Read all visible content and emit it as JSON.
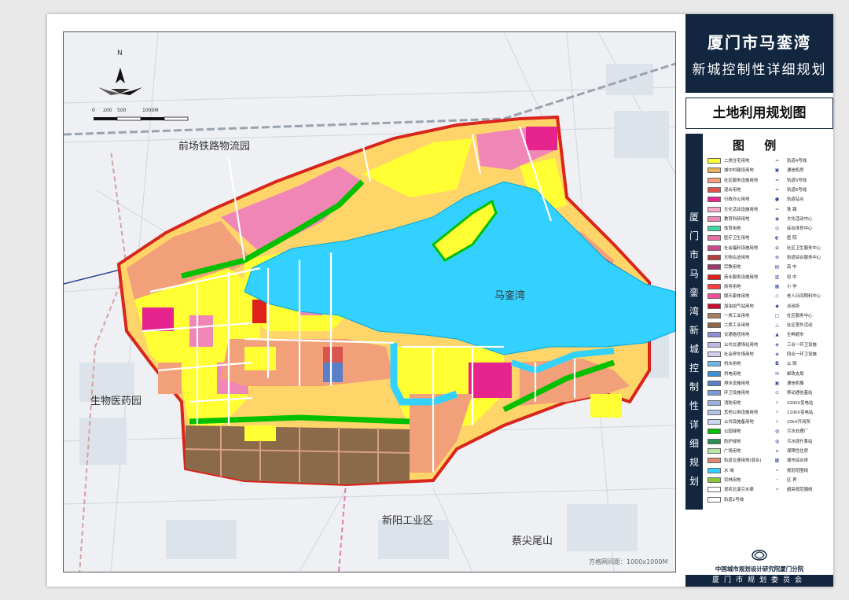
{
  "title": {
    "line1": "厦门市马銮湾",
    "line2": "新城控制性详细规划"
  },
  "subtitle": "土地利用规划图",
  "legend": {
    "heading": "图  例",
    "side_text": "厦门市马銮湾新城控制性详细规划",
    "left_items": [
      {
        "label": "二类住宅用地",
        "color": "#ffff33"
      },
      {
        "label": "城中村建设用地",
        "color": "#e8b25c"
      },
      {
        "label": "社区服务设施用地",
        "color": "#f2a07a"
      },
      {
        "label": "混合用地",
        "color": "#d9534f"
      },
      {
        "label": "行政办公用地",
        "color": "#e7238d"
      },
      {
        "label": "文化活动设施用地",
        "color": "#f7a8c9"
      },
      {
        "label": "教育科研用地",
        "color": "#f086b5"
      },
      {
        "label": "体育用地",
        "color": "#3fd4a2"
      },
      {
        "label": "医疗卫生用地",
        "color": "#e66fa3"
      },
      {
        "label": "社会福利设施用地",
        "color": "#c94b8c"
      },
      {
        "label": "文物古迹用地",
        "color": "#b0413e"
      },
      {
        "label": "宗教用地",
        "color": "#9b3b6b"
      },
      {
        "label": "商业服务设施用地",
        "color": "#e0201b"
      },
      {
        "label": "商务用地",
        "color": "#ff3b3b"
      },
      {
        "label": "娱乐康体用地",
        "color": "#f0509a"
      },
      {
        "label": "加油加气站用地",
        "color": "#c8102e"
      },
      {
        "label": "一类工业用地",
        "color": "#a58060"
      },
      {
        "label": "二类工业用地",
        "color": "#8b6a4a"
      },
      {
        "label": "交通枢纽用地",
        "color": "#8f8fd6"
      },
      {
        "label": "公共交通场站用地",
        "color": "#b9b9e3"
      },
      {
        "label": "社会停车场用地",
        "color": "#d0d0ee"
      },
      {
        "label": "供水用地",
        "color": "#6fb5e8"
      },
      {
        "label": "供电用地",
        "color": "#3f8fd1"
      },
      {
        "label": "排水设施用地",
        "color": "#5a7fc9"
      },
      {
        "label": "环卫设施用地",
        "color": "#7a9bd6"
      },
      {
        "label": "消防用地",
        "color": "#9aaee0"
      },
      {
        "label": "其他公用设施用地",
        "color": "#b0c4ea"
      },
      {
        "label": "公共设施备用地",
        "color": "#c8d6f0"
      },
      {
        "label": "公园绿地",
        "color": "#00c000"
      },
      {
        "label": "防护绿地",
        "color": "#2e8b57"
      },
      {
        "label": "广场用地",
        "color": "#b9e6a6"
      },
      {
        "label": "轨道交通用地(混合)",
        "color": "#d98b6b"
      },
      {
        "label": "水  域",
        "color": "#33d1ff"
      },
      {
        "label": "农林用地",
        "color": "#8cc63f"
      },
      {
        "label": "现状北溪引水渠",
        "color": "#ffffff"
      },
      {
        "label": "轨道2号线",
        "color": "#ffffff"
      }
    ],
    "right_items": [
      {
        "label": "轨道4号线",
        "icon": "━"
      },
      {
        "label": "通信机房",
        "icon": "▣"
      },
      {
        "label": "轨道5号线",
        "icon": "━"
      },
      {
        "label": "轨道6号线",
        "icon": "━"
      },
      {
        "label": "轨道站点",
        "icon": "●"
      },
      {
        "label": "铁  路",
        "icon": "═"
      },
      {
        "label": "文化活动中心",
        "icon": "◉"
      },
      {
        "label": "综合体育中心",
        "icon": "◎"
      },
      {
        "label": "医  院",
        "icon": "◐"
      },
      {
        "label": "社区卫生服务中心",
        "icon": "⊕"
      },
      {
        "label": "街道综合服务中心",
        "icon": "⊗"
      },
      {
        "label": "高  中",
        "icon": "▤"
      },
      {
        "label": "初  中",
        "icon": "▥"
      },
      {
        "label": "小  学",
        "icon": "▦"
      },
      {
        "label": "老人日间照料中心",
        "icon": "◇"
      },
      {
        "label": "派出所",
        "icon": "◆"
      },
      {
        "label": "社区服务中心",
        "icon": "□"
      },
      {
        "label": "社区室外活动",
        "icon": "△"
      },
      {
        "label": "生鲜超市",
        "icon": "▲"
      },
      {
        "label": "三合一环卫设施",
        "icon": "◈"
      },
      {
        "label": "四合一环卫设施",
        "icon": "◈"
      },
      {
        "label": "公  厕",
        "icon": "◘"
      },
      {
        "label": "邮政支局",
        "icon": "✉"
      },
      {
        "label": "通信机楼",
        "icon": "▣"
      },
      {
        "label": "移动通信基站",
        "icon": "⊙"
      },
      {
        "label": "220kV变电站",
        "icon": "⚡"
      },
      {
        "label": "110kV变电站",
        "icon": "⚡"
      },
      {
        "label": "10kV开闭所",
        "icon": "⚡"
      },
      {
        "label": "污水处理厂",
        "icon": "◍"
      },
      {
        "label": "污水提升泵站",
        "icon": "◍"
      },
      {
        "label": "保障性住房",
        "icon": "⌂"
      },
      {
        "label": "城市综合体",
        "icon": "▩"
      },
      {
        "label": "规划范围线",
        "icon": "┅"
      },
      {
        "label": "区  界",
        "icon": "┄"
      },
      {
        "label": "超高规范围线",
        "icon": "┅"
      }
    ]
  },
  "map": {
    "scale_labels": [
      "0",
      "200",
      "500",
      "1000M"
    ],
    "north": "N",
    "place_names": {
      "qianchang": "前场铁路物流园",
      "bay": "马銮湾",
      "biomed": "生物医药园",
      "xinyang": "新阳工业区",
      "caijian": "蔡尖尾山"
    },
    "grid_note": "方格网间距：1000x1000M"
  },
  "footer": {
    "org1": "中国城市规划设计研究院厦门分院",
    "org2": "厦门市规划委员会"
  },
  "colors": {
    "frame_navy": "#12263f",
    "water": "#33d1ff",
    "boundary": "#d9251c"
  }
}
